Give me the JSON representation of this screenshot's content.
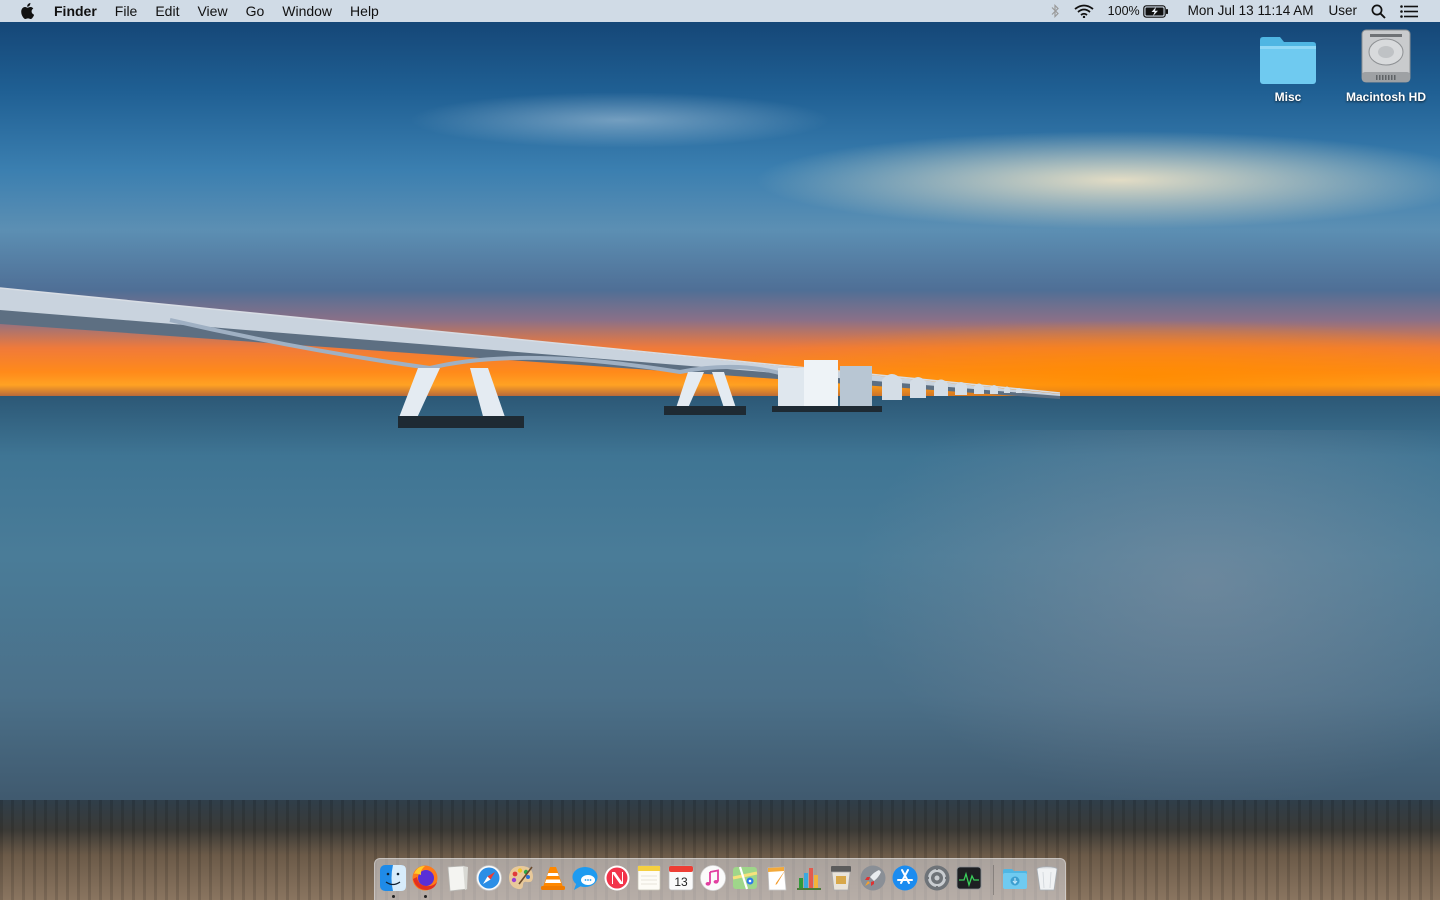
{
  "menubar": {
    "app_name": "Finder",
    "menus": [
      "File",
      "Edit",
      "View",
      "Go",
      "Window",
      "Help"
    ],
    "status": {
      "bluetooth_icon": "bluetooth-icon",
      "wifi_icon": "wifi-icon",
      "battery_percent": "100%",
      "battery_icon": "battery-charging-icon",
      "clock": "Mon Jul 13  11:14 AM",
      "user": "User",
      "spotlight_icon": "search-icon",
      "notification_icon": "notification-center-icon"
    }
  },
  "desktop": {
    "icons": [
      {
        "label": "Misc",
        "icon": "folder-icon"
      },
      {
        "label": "Macintosh HD",
        "icon": "hard-drive-icon"
      }
    ]
  },
  "dock": {
    "apps": [
      {
        "name": "Finder",
        "icon": "finder-icon",
        "running": true
      },
      {
        "name": "Firefox",
        "icon": "firefox-icon",
        "running": true
      },
      {
        "name": "TextEdit",
        "icon": "textedit-icon",
        "running": false
      },
      {
        "name": "Safari",
        "icon": "safari-icon",
        "running": false
      },
      {
        "name": "Paintbrush",
        "icon": "palette-icon",
        "running": false
      },
      {
        "name": "VLC",
        "icon": "vlc-icon",
        "running": false
      },
      {
        "name": "Messages",
        "icon": "messages-icon",
        "running": false
      },
      {
        "name": "News",
        "icon": "news-icon",
        "running": false
      },
      {
        "name": "Notes",
        "icon": "notes-icon",
        "running": false
      },
      {
        "name": "Calendar",
        "icon": "calendar-icon",
        "running": false,
        "badge_text": "13"
      },
      {
        "name": "Music",
        "icon": "music-icon",
        "running": false
      },
      {
        "name": "Maps",
        "icon": "maps-icon",
        "running": false
      },
      {
        "name": "Pages",
        "icon": "pages-icon",
        "running": false
      },
      {
        "name": "Numbers",
        "icon": "numbers-icon",
        "running": false
      },
      {
        "name": "Keynote",
        "icon": "keynote-icon",
        "running": false
      },
      {
        "name": "Launchpad",
        "icon": "launchpad-icon",
        "running": false
      },
      {
        "name": "App Store",
        "icon": "app-store-icon",
        "running": false
      },
      {
        "name": "System Preferences",
        "icon": "system-preferences-icon",
        "running": false
      },
      {
        "name": "Activity Monitor",
        "icon": "activity-monitor-icon",
        "running": false
      }
    ],
    "stacks": [
      {
        "name": "Downloads",
        "icon": "downloads-folder-icon"
      },
      {
        "name": "Trash",
        "icon": "trash-icon"
      }
    ]
  }
}
